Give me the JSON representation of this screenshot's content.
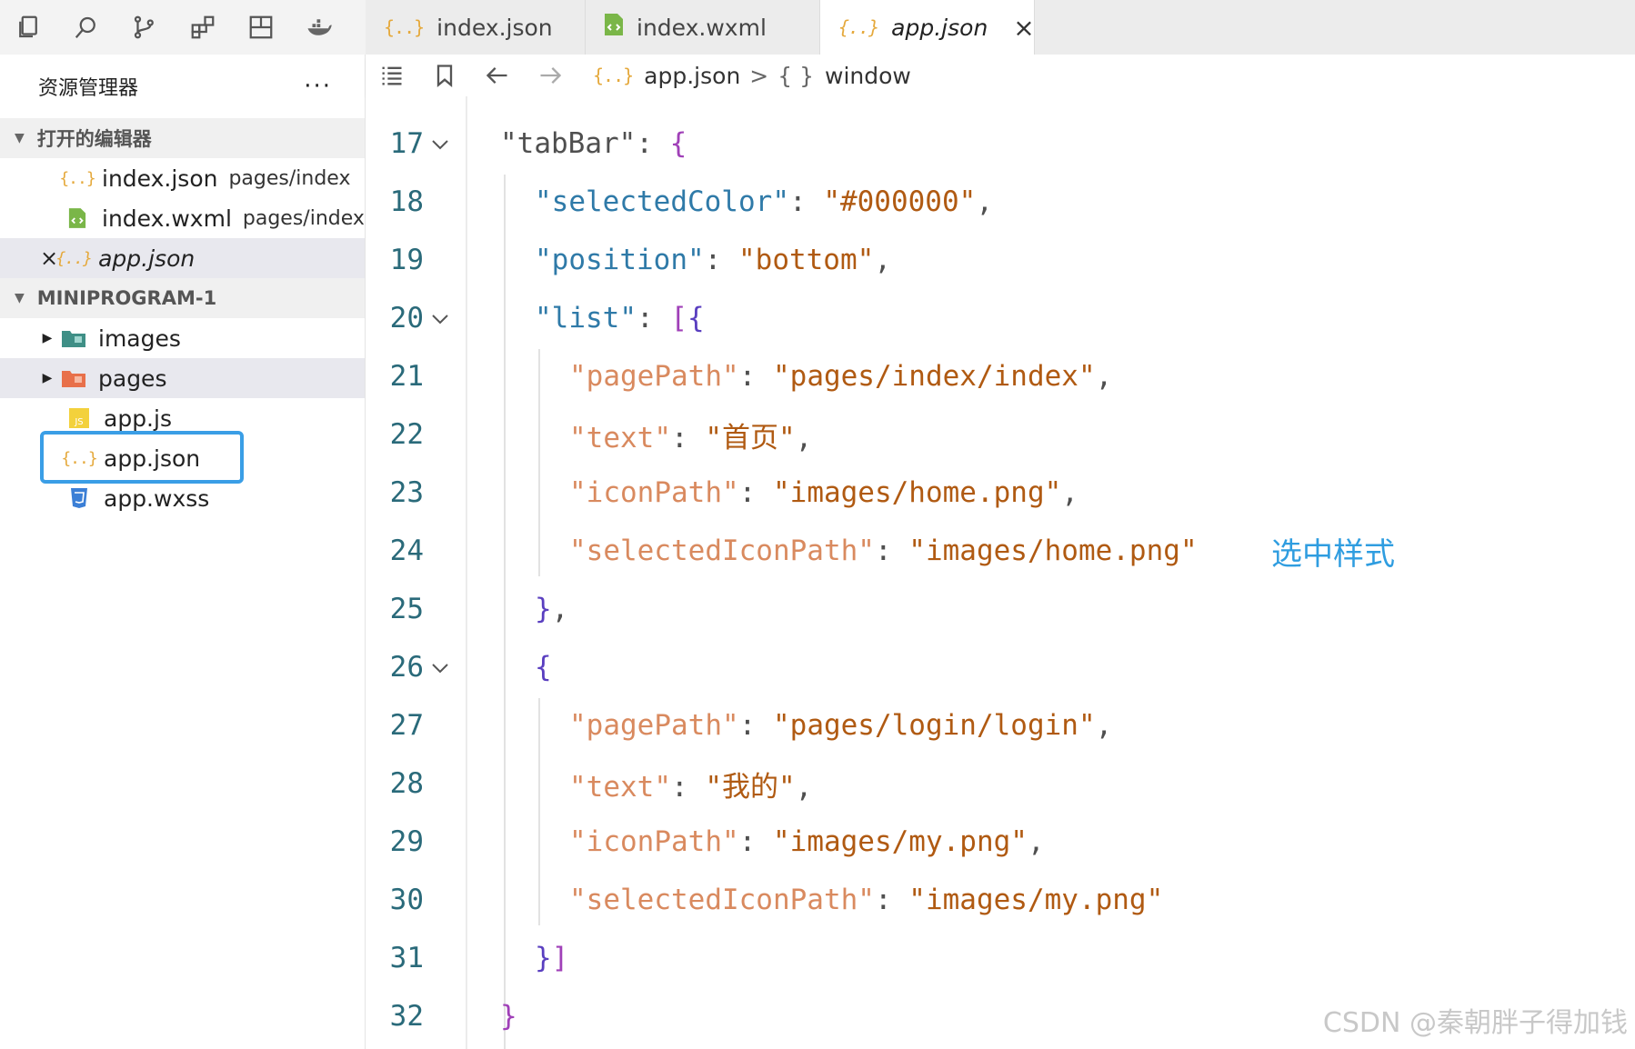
{
  "activity_bar": [
    "explorer-icon",
    "search-icon",
    "source-control-icon",
    "extensions-icon",
    "layout-icon",
    "docker-icon"
  ],
  "tabs": [
    {
      "label": "index.json",
      "icon": "json-file-icon"
    },
    {
      "label": "index.wxml",
      "icon": "wxml-file-icon"
    },
    {
      "label": "app.json",
      "icon": "json-file-icon",
      "active": true,
      "close": "×"
    }
  ],
  "sidebar": {
    "title": "资源管理器",
    "more": "···",
    "open_editors": {
      "label": "打开的编辑器",
      "items": [
        {
          "name": "index.json",
          "path": "pages/index"
        },
        {
          "name": "index.wxml",
          "path": "pages/index"
        },
        {
          "name": "app.json",
          "path": "",
          "close": "×"
        }
      ]
    },
    "project": {
      "label": "MINIPROGRAM-1",
      "items": [
        {
          "name": "images",
          "type": "folder"
        },
        {
          "name": "pages",
          "type": "folder"
        },
        {
          "name": "app.js",
          "type": "js"
        },
        {
          "name": "app.json",
          "type": "json"
        },
        {
          "name": "app.wxss",
          "type": "css"
        }
      ]
    }
  },
  "breadcrumb": {
    "file": "app.json",
    "sep": ">",
    "symbol_icon": "{ }",
    "symbol": "window"
  },
  "editor": {
    "lines": [
      {
        "n": "17",
        "fold": true
      },
      {
        "n": "18"
      },
      {
        "n": "19"
      },
      {
        "n": "20",
        "fold": true
      },
      {
        "n": "21"
      },
      {
        "n": "22"
      },
      {
        "n": "23"
      },
      {
        "n": "24"
      },
      {
        "n": "25"
      },
      {
        "n": "26",
        "fold": true
      },
      {
        "n": "27"
      },
      {
        "n": "28"
      },
      {
        "n": "29"
      },
      {
        "n": "30"
      },
      {
        "n": "31"
      },
      {
        "n": "32"
      }
    ],
    "code": {
      "tabBar": "tabBar",
      "selectedColor": "selectedColor",
      "selectedColor_val": "#000000",
      "position": "position",
      "position_val": "bottom",
      "list": "list",
      "pagePath": "pagePath",
      "pagePath1_val": "pages/index/index",
      "text": "text",
      "text1_val": "首页",
      "iconPath": "iconPath",
      "iconPath1_val": "images/home.png",
      "selectedIconPath": "selectedIconPath",
      "selectedIconPath1_val": "images/home.png",
      "pagePath2_val": "pages/login/login",
      "text2_val": "我的",
      "iconPath2_val": "images/my.png",
      "selectedIconPath2_val": "images/my.png"
    },
    "annotation": "选中样式"
  },
  "watermark": "CSDN @秦朝胖子得加钱",
  "colors": {
    "selection_box": "#3a9ee6",
    "json_icon": "#e5a93c",
    "annotation": "#2f9de0"
  }
}
